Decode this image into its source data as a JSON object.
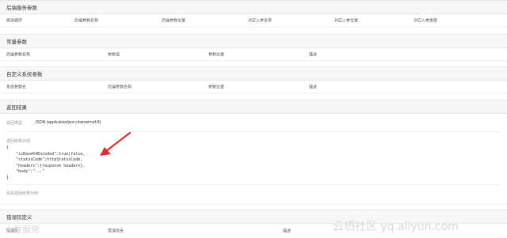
{
  "backend_params": {
    "title": "后端服务参数",
    "columns": [
      "修改顺序",
      "后端参数名称",
      "后端参数位置",
      "对应入参名称",
      "对应入参位置",
      "对应入参类型"
    ]
  },
  "constant_params": {
    "title": "常量参数",
    "columns": [
      "后端参数名称",
      "参数值",
      "参数位置",
      "描述"
    ]
  },
  "system_params": {
    "title": "自定义系统参数",
    "columns": [
      "系统参数名",
      "后端参数名称",
      "参数位置",
      "描述"
    ]
  },
  "return_result": {
    "title": "返回结果",
    "type_label": "返回类型:",
    "type_value": "JSON (application/json;charset=utf-8)",
    "example_label": "返回结果示例:",
    "example_lines": [
      "{",
      "    \"isBase64Encoded\":true|false,",
      "    \"statusCode\":httpStatusCode,",
      "    \"headers\":{response headers},",
      "    \"body\":\"...\"",
      "}"
    ],
    "failure_label": "失败返回结果示例:"
  },
  "error_codes": {
    "title": "错误码定义",
    "columns": [
      "错误码",
      "错误信息",
      "描述"
    ]
  },
  "watermarks": {
    "left": "大数据佬",
    "right": "云栖社区 yq.aliyun.com"
  },
  "colors": {
    "arrow": "#d9302c",
    "section_bg": "#f7f7f7"
  }
}
